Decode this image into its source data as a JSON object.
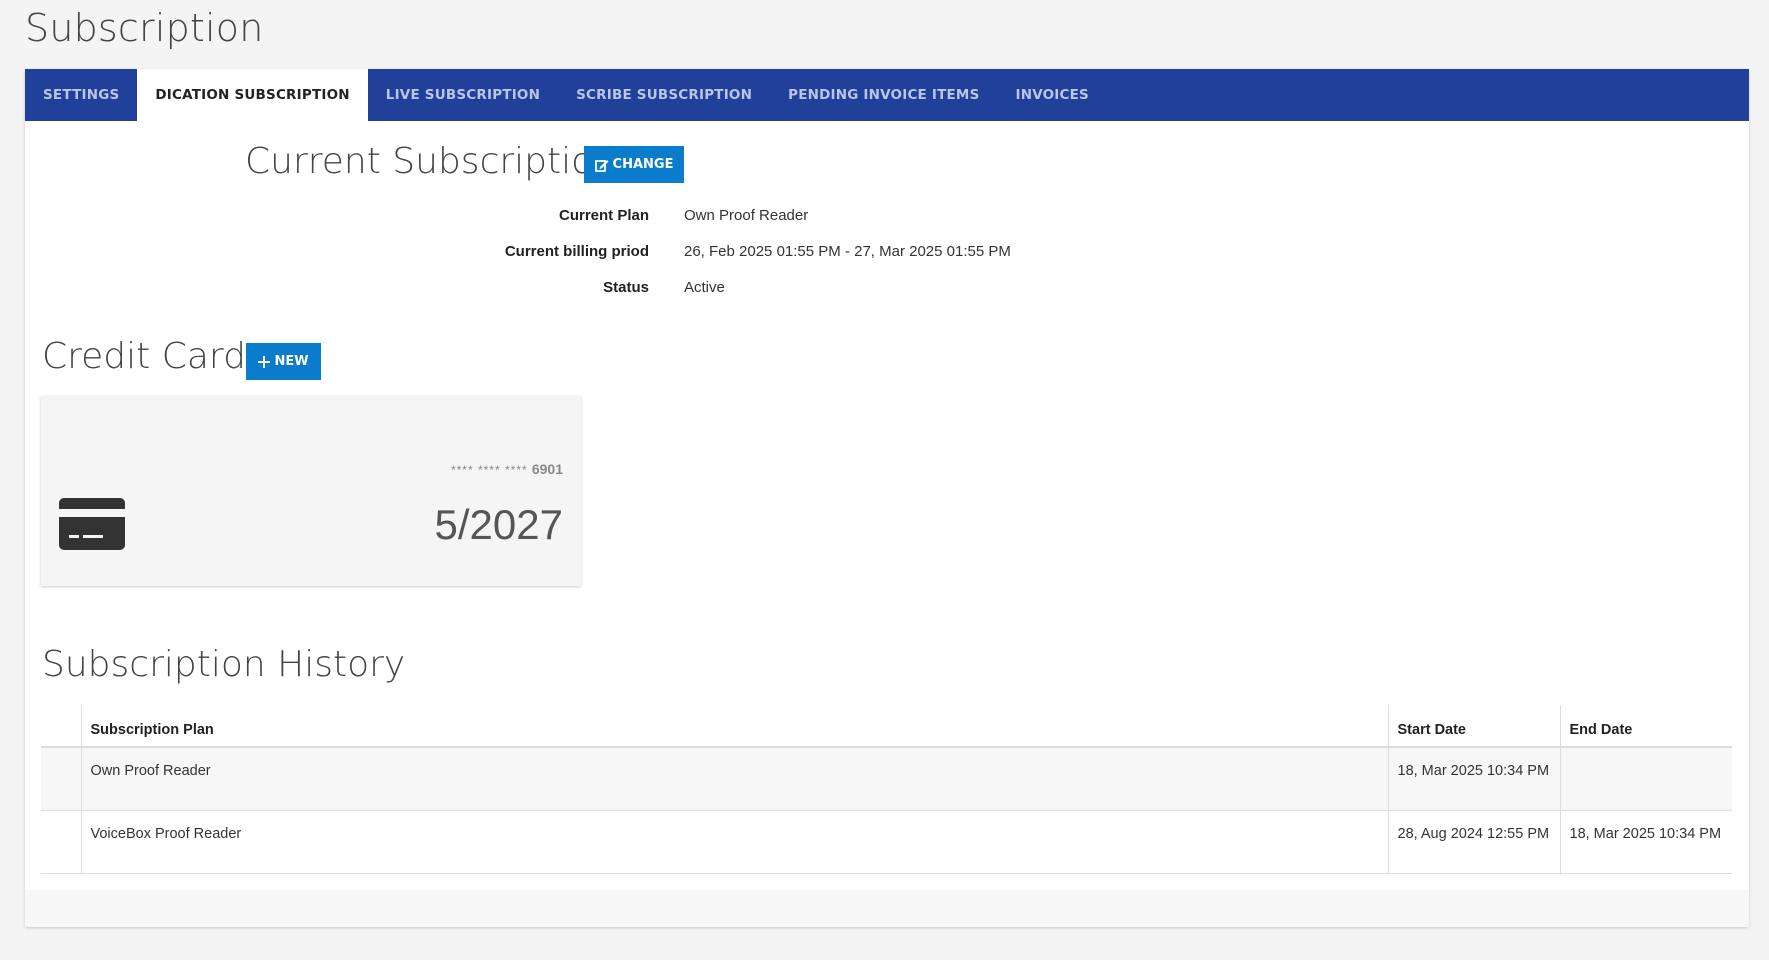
{
  "page": {
    "title": "Subscription"
  },
  "tabs": [
    {
      "label": "SETTINGS",
      "active": false
    },
    {
      "label": "DICATION SUBSCRIPTION",
      "active": true
    },
    {
      "label": "LIVE SUBSCRIPTION",
      "active": false
    },
    {
      "label": "SCRIBE SUBSCRIPTION",
      "active": false
    },
    {
      "label": "PENDING INVOICE ITEMS",
      "active": false
    },
    {
      "label": "INVOICES",
      "active": false
    }
  ],
  "current_subscription": {
    "heading": "Current Subscription",
    "change_label": "CHANGE",
    "change_icon": "edit-icon",
    "rows": [
      {
        "label": "Current Plan",
        "value": "Own Proof Reader"
      },
      {
        "label": "Current billing priod",
        "value": "26, Feb 2025 01:55 PM - 27, Mar 2025 01:55 PM"
      },
      {
        "label": "Status",
        "value": "Active"
      }
    ]
  },
  "credit_cards": {
    "heading": "Credit Cards",
    "new_label": "NEW",
    "new_icon": "plus-icon",
    "card": {
      "masked": "**** **** ****",
      "last4": "6901",
      "expiry": "5/2027",
      "icon": "credit-card-icon"
    }
  },
  "history": {
    "heading": "Subscription History",
    "columns": [
      "",
      "Subscription Plan",
      "Start Date",
      "End Date"
    ],
    "rows": [
      {
        "plan": "Own Proof Reader",
        "start": "18, Mar 2025 10:34 PM",
        "end": ""
      },
      {
        "plan": "VoiceBox Proof Reader",
        "start": "28, Aug 2024 12:55 PM",
        "end": "18, Mar 2025 10:34 PM"
      }
    ]
  },
  "colors": {
    "tab_bar": "#21409a",
    "button": "#0a7ccb",
    "background": "#f4f4f4"
  }
}
